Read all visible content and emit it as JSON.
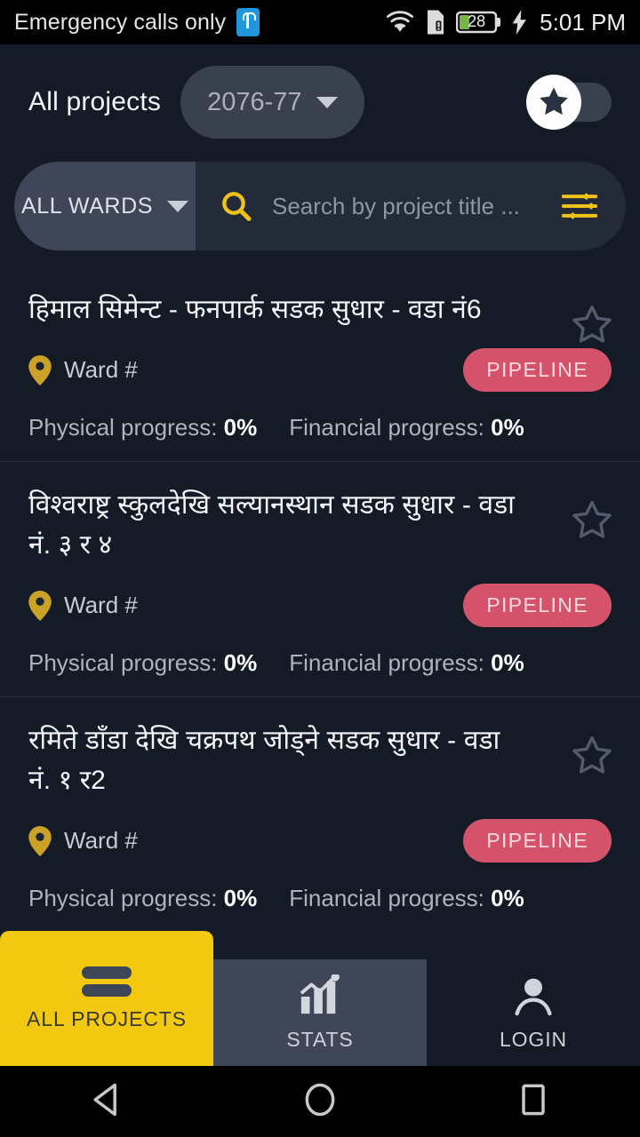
{
  "statusbar": {
    "carrier": "Emergency calls only",
    "usb_icon": "usb-icon",
    "wifi_icon": "wifi-icon",
    "sim_icon": "sim-alert-icon",
    "battery_icon": "battery-icon",
    "battery_level": "28",
    "charging_icon": "charging-bolt-icon",
    "time": "5:01 PM"
  },
  "header": {
    "title": "All projects",
    "year": "2076-77",
    "year_caret_icon": "chevron-down-icon",
    "favorite_toggle_icon": "star-icon",
    "favorite_toggle_state": "off"
  },
  "search": {
    "wards_label": "ALL WARDS",
    "wards_caret_icon": "chevron-down-icon",
    "search_icon": "search-icon",
    "placeholder": "Search by project title ...",
    "filter_icon": "filter-sliders-icon"
  },
  "colors": {
    "background": "#141b26",
    "accent_yellow": "#f2c811",
    "badge_pink": "#d4536a",
    "panel_gray": "#3e4658",
    "search_bg": "#232b38"
  },
  "projects": [
    {
      "title": "हिमाल सिमेन्ट - फनपार्क सडक सुधार - वडा नं6",
      "pin_icon": "map-pin-icon",
      "ward": "Ward #",
      "status": "PIPELINE",
      "star_icon": "star-outline-icon",
      "physical_label": "Physical progress:",
      "physical_value": "0%",
      "financial_label": "Financial progress:",
      "financial_value": "0%"
    },
    {
      "title": "विश्वराष्ट्र स्कुलदेखि सल्यानस्थान सडक सुधार - वडा नं. ३ र ४",
      "pin_icon": "map-pin-icon",
      "ward": "Ward #",
      "status": "PIPELINE",
      "star_icon": "star-outline-icon",
      "physical_label": "Physical progress:",
      "physical_value": "0%",
      "financial_label": "Financial progress:",
      "financial_value": "0%"
    },
    {
      "title": "रमिते डाँडा देखि चक्रपथ जोड्ने सडक सुधार - वडा नं. १ र2",
      "pin_icon": "map-pin-icon",
      "ward": "Ward #",
      "status": "PIPELINE",
      "star_icon": "star-outline-icon",
      "physical_label": "Physical progress:",
      "physical_value": "0%",
      "financial_label": "Financial progress:",
      "financial_value": "0%"
    }
  ],
  "bottom_nav": [
    {
      "label": "ALL PROJECTS",
      "icon": "list-icon",
      "active": true
    },
    {
      "label": "STATS",
      "icon": "bar-chart-icon",
      "active": false
    },
    {
      "label": "LOGIN",
      "icon": "person-icon",
      "active": false
    }
  ],
  "android_nav": {
    "back_icon": "back-triangle-icon",
    "home_icon": "home-circle-icon",
    "recents_icon": "recents-square-icon"
  }
}
